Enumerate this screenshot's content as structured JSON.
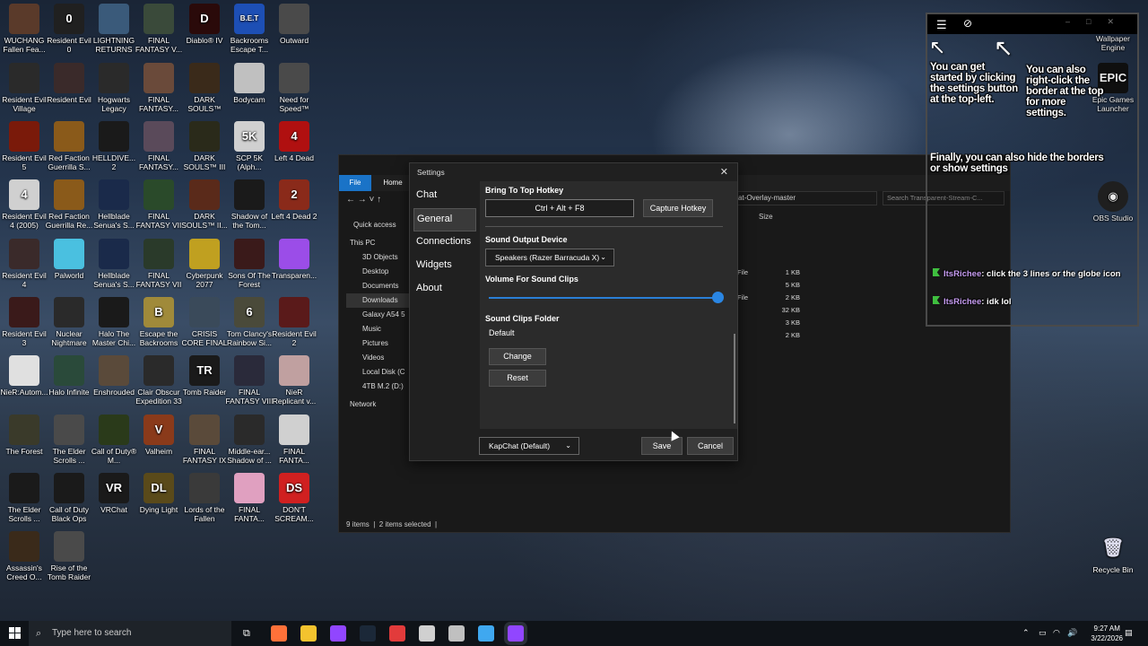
{
  "desktop": {
    "icons": [
      {
        "label": "WUCHANG Fallen Fea...",
        "color": "#5a3a2a",
        "glyph": ""
      },
      {
        "label": "Resident Evil 0",
        "color": "#202020",
        "glyph": "0"
      },
      {
        "label": "LIGHTNING RETURNS F...",
        "color": "#3a5a7a",
        "glyph": ""
      },
      {
        "label": "FINAL FANTASY V...",
        "color": "#3a4a3a",
        "glyph": ""
      },
      {
        "label": "Diablo® IV",
        "color": "#2a0a0a",
        "glyph": "D"
      },
      {
        "label": "Backrooms Escape T...",
        "color": "#1d4fb5",
        "glyph": "B.E.T"
      },
      {
        "label": "Outward",
        "color": "#4a4a4a",
        "glyph": ""
      },
      {
        "label": "Resident Evil Village",
        "color": "#2a2a2a",
        "glyph": ""
      },
      {
        "label": "Resident Evil",
        "color": "#3a2a2a",
        "glyph": ""
      },
      {
        "label": "Hogwarts Legacy",
        "color": "#2a2a2a",
        "glyph": ""
      },
      {
        "label": "FINAL FANTASY...",
        "color": "#6a4a3a",
        "glyph": ""
      },
      {
        "label": "DARK SOULS™ Re...",
        "color": "#3a2a1a",
        "glyph": ""
      },
      {
        "label": "Bodycam",
        "color": "#c0c0c0",
        "glyph": ""
      },
      {
        "label": "Need for Speed™",
        "color": "#4a4a4a",
        "glyph": ""
      },
      {
        "label": "Resident Evil 5",
        "color": "#7a1a0a",
        "glyph": ""
      },
      {
        "label": "Red Faction Guerrilla S...",
        "color": "#8a5a1a",
        "glyph": ""
      },
      {
        "label": "HELLDIVE... 2",
        "color": "#1a1a1a",
        "glyph": ""
      },
      {
        "label": "FINAL FANTASY...",
        "color": "#5a4a5a",
        "glyph": ""
      },
      {
        "label": "DARK SOULS™ III",
        "color": "#2a2a1a",
        "glyph": ""
      },
      {
        "label": "SCP 5K (Alph...",
        "color": "#d0d0d0",
        "glyph": "5K"
      },
      {
        "label": "Left 4 Dead",
        "color": "#b01010",
        "glyph": "4"
      },
      {
        "label": "Resident Evil 4 (2005)",
        "color": "#d0d0d0",
        "glyph": "4"
      },
      {
        "label": "Red Faction Guerrilla Re...",
        "color": "#8a5a1a",
        "glyph": ""
      },
      {
        "label": "Hellblade Senua's S...",
        "color": "#1a2a4a",
        "glyph": ""
      },
      {
        "label": "FINAL FANTASY VII",
        "color": "#2a4a2a",
        "glyph": ""
      },
      {
        "label": "DARK SOULS™ II...",
        "color": "#5a2a1a",
        "glyph": ""
      },
      {
        "label": "Shadow of the Tom...",
        "color": "#1a1a1a",
        "glyph": ""
      },
      {
        "label": "Left 4 Dead 2",
        "color": "#8a2a1a",
        "glyph": "2"
      },
      {
        "label": "Resident Evil 4",
        "color": "#3a2a2a",
        "glyph": ""
      },
      {
        "label": "Palworld",
        "color": "#4ac0e0",
        "glyph": ""
      },
      {
        "label": "Hellblade Senua's S...",
        "color": "#1a2a4a",
        "glyph": ""
      },
      {
        "label": "FINAL FANTASY VII",
        "color": "#2a3a2a",
        "glyph": ""
      },
      {
        "label": "Cyberpunk 2077",
        "color": "#c0a020",
        "glyph": ""
      },
      {
        "label": "Sons Of The Forest",
        "color": "#3a1a1a",
        "glyph": ""
      },
      {
        "label": "Transparen...",
        "color": "#9b4de8",
        "glyph": ""
      },
      {
        "label": "Resident Evil 3",
        "color": "#3a1a1a",
        "glyph": ""
      },
      {
        "label": "Nuclear Nightmare",
        "color": "#2a2a2a",
        "glyph": ""
      },
      {
        "label": "Halo The Master Chi...",
        "color": "#1a1a1a",
        "glyph": ""
      },
      {
        "label": "Escape the Backrooms",
        "color": "#a08a3a",
        "glyph": "B"
      },
      {
        "label": "CRISIS CORE FINAL F...",
        "color": "#3a4a5a",
        "glyph": ""
      },
      {
        "label": "Tom Clancy's Rainbow Si...",
        "color": "#4a4a3a",
        "glyph": "6"
      },
      {
        "label": "Resident Evil 2",
        "color": "#5a1a1a",
        "glyph": ""
      },
      {
        "label": "NieR:Autom...",
        "color": "#e0e0e0",
        "glyph": ""
      },
      {
        "label": "Halo Infinite",
        "color": "#2a4a3a",
        "glyph": ""
      },
      {
        "label": "Enshrouded",
        "color": "#5a4a3a",
        "glyph": ""
      },
      {
        "label": "Clair Obscur Expedition 33",
        "color": "#2a2a2a",
        "glyph": ""
      },
      {
        "label": "Tomb Raider",
        "color": "#1a1a1a",
        "glyph": "TR"
      },
      {
        "label": "FINAL FANTASY VIII",
        "color": "#2a2a3a",
        "glyph": ""
      },
      {
        "label": "NieR Replicant v...",
        "color": "#c0a0a0",
        "glyph": ""
      },
      {
        "label": "The Forest",
        "color": "#3a3a2a",
        "glyph": ""
      },
      {
        "label": "The Elder Scrolls ...",
        "color": "#4a4a4a",
        "glyph": ""
      },
      {
        "label": "Call of Duty® M...",
        "color": "#2a3a1a",
        "glyph": ""
      },
      {
        "label": "Valheim",
        "color": "#8a3a1a",
        "glyph": "V"
      },
      {
        "label": "FINAL FANTASY IX",
        "color": "#5a4a3a",
        "glyph": ""
      },
      {
        "label": "Middle-ear... Shadow of ...",
        "color": "#2a2a2a",
        "glyph": ""
      },
      {
        "label": "FINAL FANTA...",
        "color": "#d0d0d0",
        "glyph": ""
      },
      {
        "label": "The Elder Scrolls ...",
        "color": "#1a1a1a",
        "glyph": ""
      },
      {
        "label": "Call of Duty Black Ops",
        "color": "#1a1a1a",
        "glyph": ""
      },
      {
        "label": "VRChat",
        "color": "#1a1a1a",
        "glyph": "VR"
      },
      {
        "label": "Dying Light",
        "color": "#5a4a1a",
        "glyph": "DL"
      },
      {
        "label": "Lords of the Fallen",
        "color": "#3a3a3a",
        "glyph": ""
      },
      {
        "label": "FINAL FANTA...",
        "color": "#e0a0c0",
        "glyph": ""
      },
      {
        "label": "DON'T SCREAM...",
        "color": "#d02020",
        "glyph": "DS"
      },
      {
        "label": "Assassin's Creed O...",
        "color": "#3a2a1a",
        "glyph": ""
      },
      {
        "label": "Rise of the Tomb Raider",
        "color": "#4a4a4a",
        "glyph": ""
      }
    ],
    "right_icons": {
      "wallpaper_engine": "Wallpaper Engine",
      "epic_games": "Epic Games Launcher",
      "obs": "OBS Studio",
      "recycle_bin": "Recycle Bin"
    }
  },
  "explorer": {
    "file_tab": "File",
    "home_tab": "Home",
    "address_fragment": "at-Overlay-master",
    "search_placeholder": "Search Transparent-Stream-C...",
    "size_header": "Size",
    "nav": [
      "Quick access",
      "This PC",
      "3D Objects",
      "Desktop",
      "Documents",
      "Downloads",
      "Galaxy A54 5",
      "Music",
      "Pictures",
      "Videos",
      "Local Disk (C",
      "4TB M.2 (D:)",
      "Network"
    ],
    "file_types": [
      "File",
      "",
      "File",
      "",
      "",
      ""
    ],
    "sizes": [
      "1 KB",
      "5 KB",
      "2 KB",
      "32 KB",
      "3 KB",
      "2 KB"
    ],
    "status_items": "9 items",
    "status_selected": "2 items selected"
  },
  "settings": {
    "title": "Settings",
    "close": "✕",
    "nav": [
      "Chat",
      "General",
      "Connections",
      "Widgets",
      "About"
    ],
    "active_nav": "General",
    "hotkey_label": "Bring To Top Hotkey",
    "hotkey_value": "Ctrl + Alt + F8",
    "capture_button": "Capture Hotkey",
    "sound_output_label": "Sound Output Device",
    "sound_output_value": "Speakers (Razer Barracuda X)",
    "volume_label": "Volume For Sound Clips",
    "volume_level": 1.0,
    "folder_label": "Sound Clips Folder",
    "folder_value": "Default",
    "change_button": "Change",
    "reset_button": "Reset",
    "theme_value": "KapChat (Default)",
    "save_button": "Save",
    "cancel_button": "Cancel"
  },
  "overlay": {
    "help_1": "You can get started by clicking the settings button at the top-left.",
    "help_2": "You can also right-click the border at the top for more settings.",
    "help_3": "Finally, you can also hide the borders or show settings",
    "chat": [
      {
        "user": "ItsRichee",
        "message": "click the 3 lines or the globe icon"
      },
      {
        "user": "ItsRichee",
        "message": "idk lol"
      }
    ]
  },
  "taskbar": {
    "search_placeholder": "Type here to search",
    "time": "9:27 AM",
    "date": "3/22/2026",
    "colors": [
      "#ff7139",
      "#f3c32e",
      "#9146ff",
      "#1b2838",
      "#e23b3b",
      "#d0d0d0",
      "#c0c0c0",
      "#3fa8f0",
      "#9146ff"
    ]
  }
}
